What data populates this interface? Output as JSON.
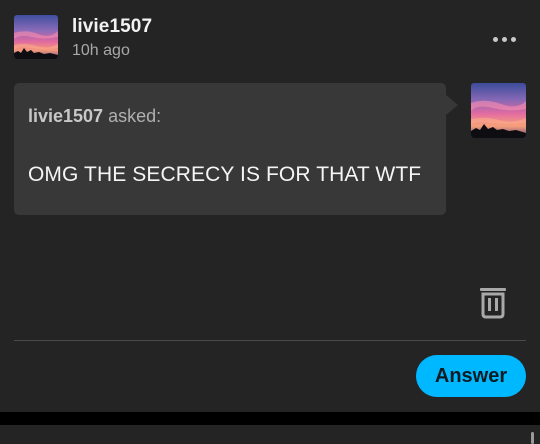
{
  "post": {
    "username": "livie1507",
    "timestamp": "10h ago",
    "avatar": "sunset-avatar"
  },
  "ask": {
    "asker": "livie1507",
    "asked_suffix": "asked:",
    "question": "OMG THE SECRECY IS FOR THAT WTF",
    "avatar": "sunset-avatar"
  },
  "actions": {
    "more_icon": "more-dots-icon",
    "delete_icon": "trash-icon",
    "answer_label": "Answer"
  },
  "colors": {
    "background": "#242424",
    "bubble": "#383838",
    "accent": "#00b8ff",
    "text_primary": "#f2f2f2",
    "text_secondary": "#a8a8a8"
  }
}
